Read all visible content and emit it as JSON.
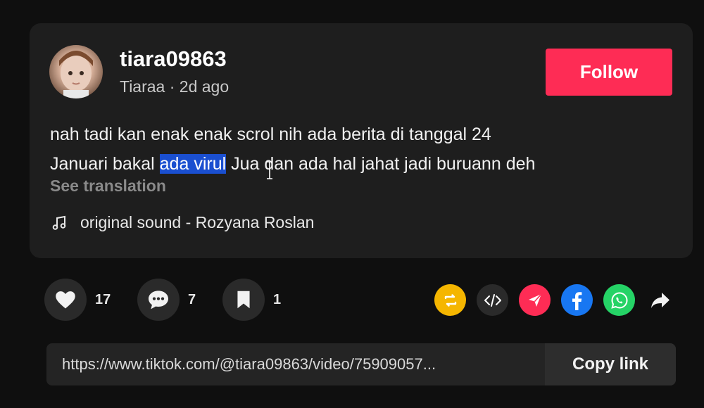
{
  "post": {
    "username": "tiara09863",
    "display_name": "Tiaraa",
    "separator": " · ",
    "time_ago": "2d ago",
    "follow_label": "Follow",
    "description": {
      "line1": "nah tadi kan enak enak scrol nih ada berita di tanggal 24",
      "line2_before": "Januari bakal ",
      "line2_highlight": "ada virul",
      "line2_after": " Jua dan ada hal jahat jadi buruann deh"
    },
    "see_translation": "See translation",
    "sound": "original sound - Rozyana Roslan"
  },
  "actions": {
    "likes": "17",
    "comments": "7",
    "saves": "1"
  },
  "share": {
    "icons": [
      "repost-icon",
      "embed-icon",
      "send-to-friends-icon",
      "facebook-icon",
      "whatsapp-icon",
      "share-arrow-icon"
    ]
  },
  "link_bar": {
    "url": "https://www.tiktok.com/@tiara09863/video/75909057...",
    "copy_label": "Copy link"
  },
  "colors": {
    "follow": "#fe2c55",
    "highlight": "#1a4fd0",
    "repost": "#f5b600",
    "send": "#fe2c55",
    "facebook": "#1877f2",
    "whatsapp": "#25d366"
  }
}
